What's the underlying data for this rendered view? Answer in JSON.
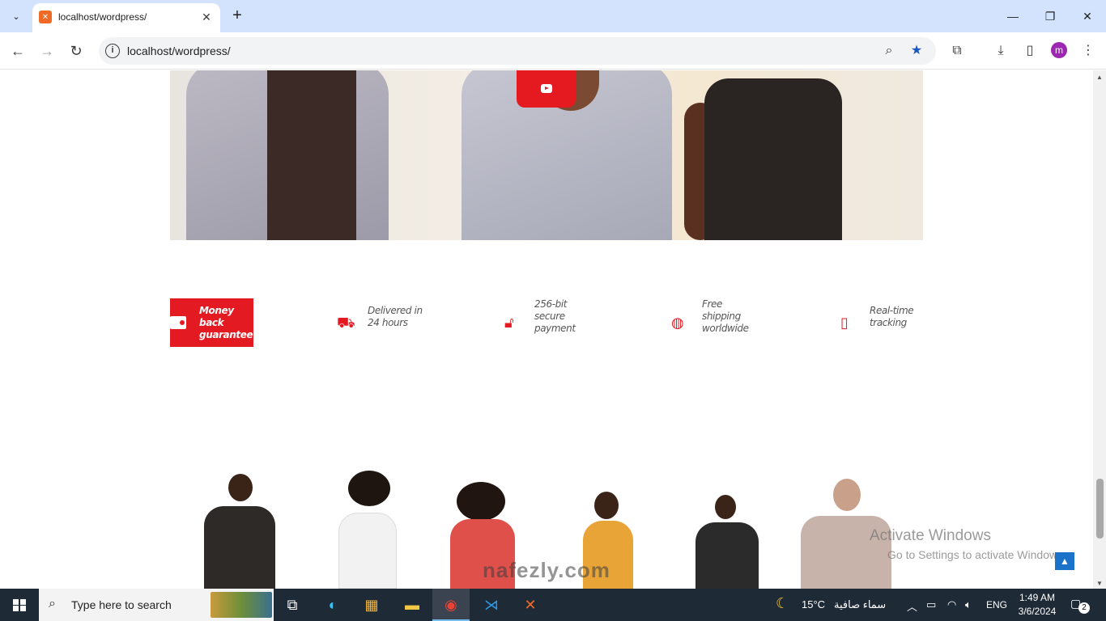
{
  "browser": {
    "tab_title": "localhost/wordpress/",
    "url": "localhost/wordpress/",
    "profile_initial": "m"
  },
  "features": [
    {
      "icon": "wallet-icon",
      "text": "Money back guarantee",
      "lines": [
        "Money back",
        "guarantee"
      ]
    },
    {
      "icon": "truck-icon",
      "text": "Delivered in 24 hours",
      "lines": [
        "Delivered in",
        "24 hours"
      ]
    },
    {
      "icon": "lock-icon",
      "text": "256-bit secure payment",
      "lines": [
        "256-bit",
        "secure",
        "payment"
      ]
    },
    {
      "icon": "globe-icon",
      "text": "Free shipping worldwide",
      "lines": [
        "Free",
        "shipping",
        "worldwide"
      ]
    },
    {
      "icon": "mobile-icon",
      "text": "Real-time tracking",
      "lines": [
        "Real-time",
        "tracking"
      ]
    }
  ],
  "overlay": {
    "activate_title": "Activate Windows",
    "activate_sub": "Go to Settings to activate Windows.",
    "watermark": "nafezly.com"
  },
  "taskbar": {
    "search_placeholder": "Type here to search",
    "weather_temp": "15°C",
    "weather_text": "سماء صافية",
    "language": "ENG",
    "time": "1:49 AM",
    "date": "3/6/2024",
    "notification_count": "2"
  },
  "colors": {
    "accent_red": "#e31a22",
    "youtube_red": "#e51a20",
    "taskbar_bg": "#1f2a37",
    "tabstrip_bg": "#d3e3fd",
    "scroll_top_blue": "#1a73c9"
  }
}
